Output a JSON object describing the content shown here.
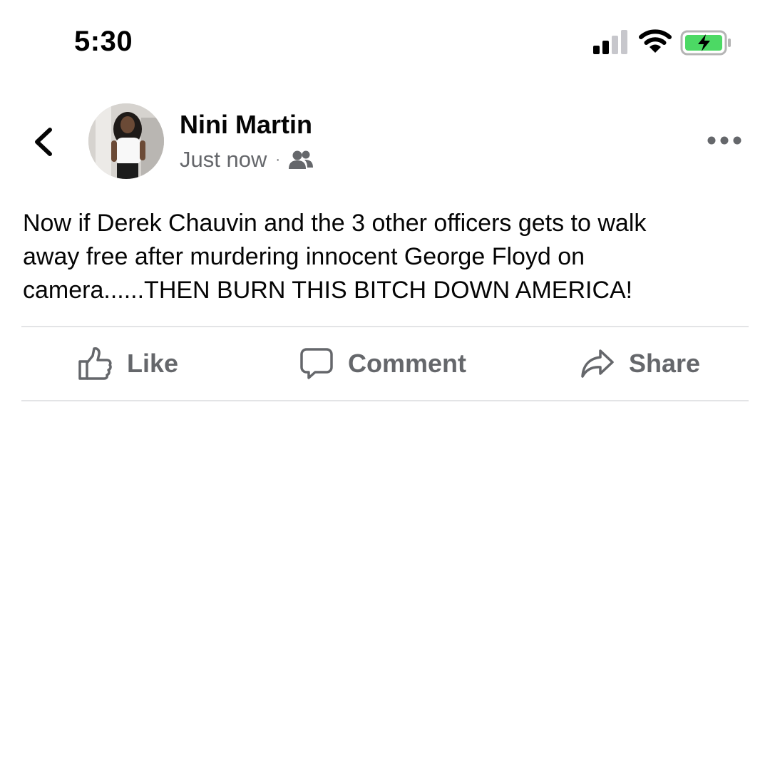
{
  "status_bar": {
    "time": "5:30",
    "signal_icon": "cellular-signal-icon",
    "wifi_icon": "wifi-icon",
    "battery_icon": "battery-charging-icon",
    "battery_color": "#4cd964"
  },
  "post": {
    "author": "Nini Martin",
    "timestamp": "Just now",
    "separator": "·",
    "audience_icon": "friends-icon",
    "text": "Now if Derek Chauvin and the 3 other officers gets to walk\naway free after murdering innocent George Floyd on\ncamera......THEN BURN THIS BITCH DOWN AMERICA!"
  },
  "actions": {
    "like": "Like",
    "comment": "Comment",
    "share": "Share"
  },
  "colors": {
    "secondary_text": "#65676b",
    "primary_text": "#050505",
    "divider": "#e3e4e6"
  }
}
